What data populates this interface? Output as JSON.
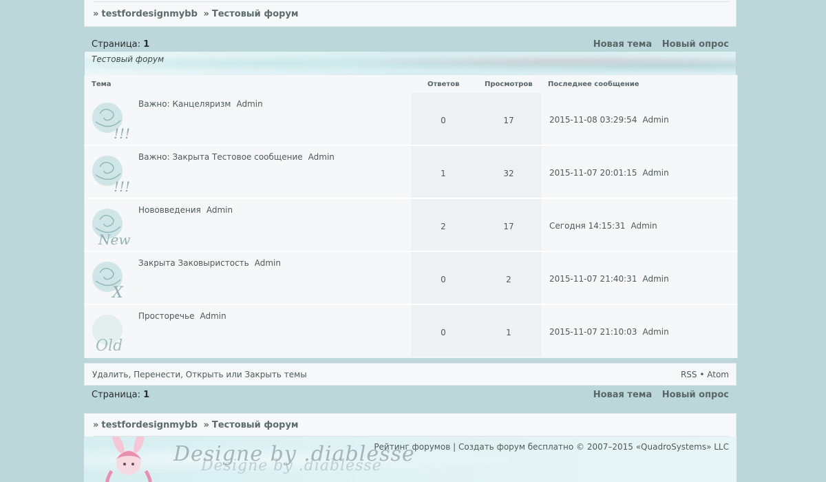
{
  "breadcrumb": {
    "sep": "»",
    "root": "testfordesignmybb",
    "forum": "Тестовый форум"
  },
  "pagination": {
    "label": "Страница:",
    "current": "1"
  },
  "actions": {
    "new_topic": "Новая тема",
    "new_poll": "Новый опрос"
  },
  "forum_title": "Тестовый форум",
  "columns": {
    "topic": "Тема",
    "replies": "Ответов",
    "views": "Просмотров",
    "last_post": "Последнее сообщение"
  },
  "topics": [
    {
      "title": "Важно: Канцеляризм",
      "author": "Admin",
      "replies": "0",
      "views": "17",
      "last_date": "2015-11-08 03:29:54",
      "last_author": "Admin",
      "icon": "sticky-icon",
      "icon_mark": "!!!"
    },
    {
      "title": "Важно: Закрыта Тестовое сообщение",
      "author": "Admin",
      "replies": "1",
      "views": "32",
      "last_date": "2015-11-07 20:01:15",
      "last_author": "Admin",
      "icon": "sticky-icon",
      "icon_mark": "!!!"
    },
    {
      "title": "Нововведения",
      "author": "Admin",
      "replies": "2",
      "views": "17",
      "last_date": "Сегодня 14:15:31",
      "last_author": "Admin",
      "icon": "new-icon",
      "icon_mark": "New"
    },
    {
      "title": "Закрыта Заковыристость",
      "author": "Admin",
      "replies": "0",
      "views": "2",
      "last_date": "2015-11-07 21:40:31",
      "last_author": "Admin",
      "icon": "closed-icon",
      "icon_mark": "X"
    },
    {
      "title": "Просторечье",
      "author": "Admin",
      "replies": "0",
      "views": "1",
      "last_date": "2015-11-07 21:10:03",
      "last_author": "Admin",
      "icon": "old-icon",
      "icon_mark": "Old"
    }
  ],
  "moderation": {
    "text": "Удалить, Перенести, Открыть или Закрыть темы"
  },
  "feeds": {
    "rss": "RSS",
    "dot": "•",
    "atom": "Atom"
  },
  "footer": {
    "links": "Рейтинг форумов | Создать форум бесплатно © 2007–2015 «QuadroSystems» LLC",
    "signature": "Designe by .diablesse"
  },
  "colors": {
    "background": "#bcd7da",
    "panel": "#f6f8f9",
    "accent": "#a8cfd2"
  }
}
